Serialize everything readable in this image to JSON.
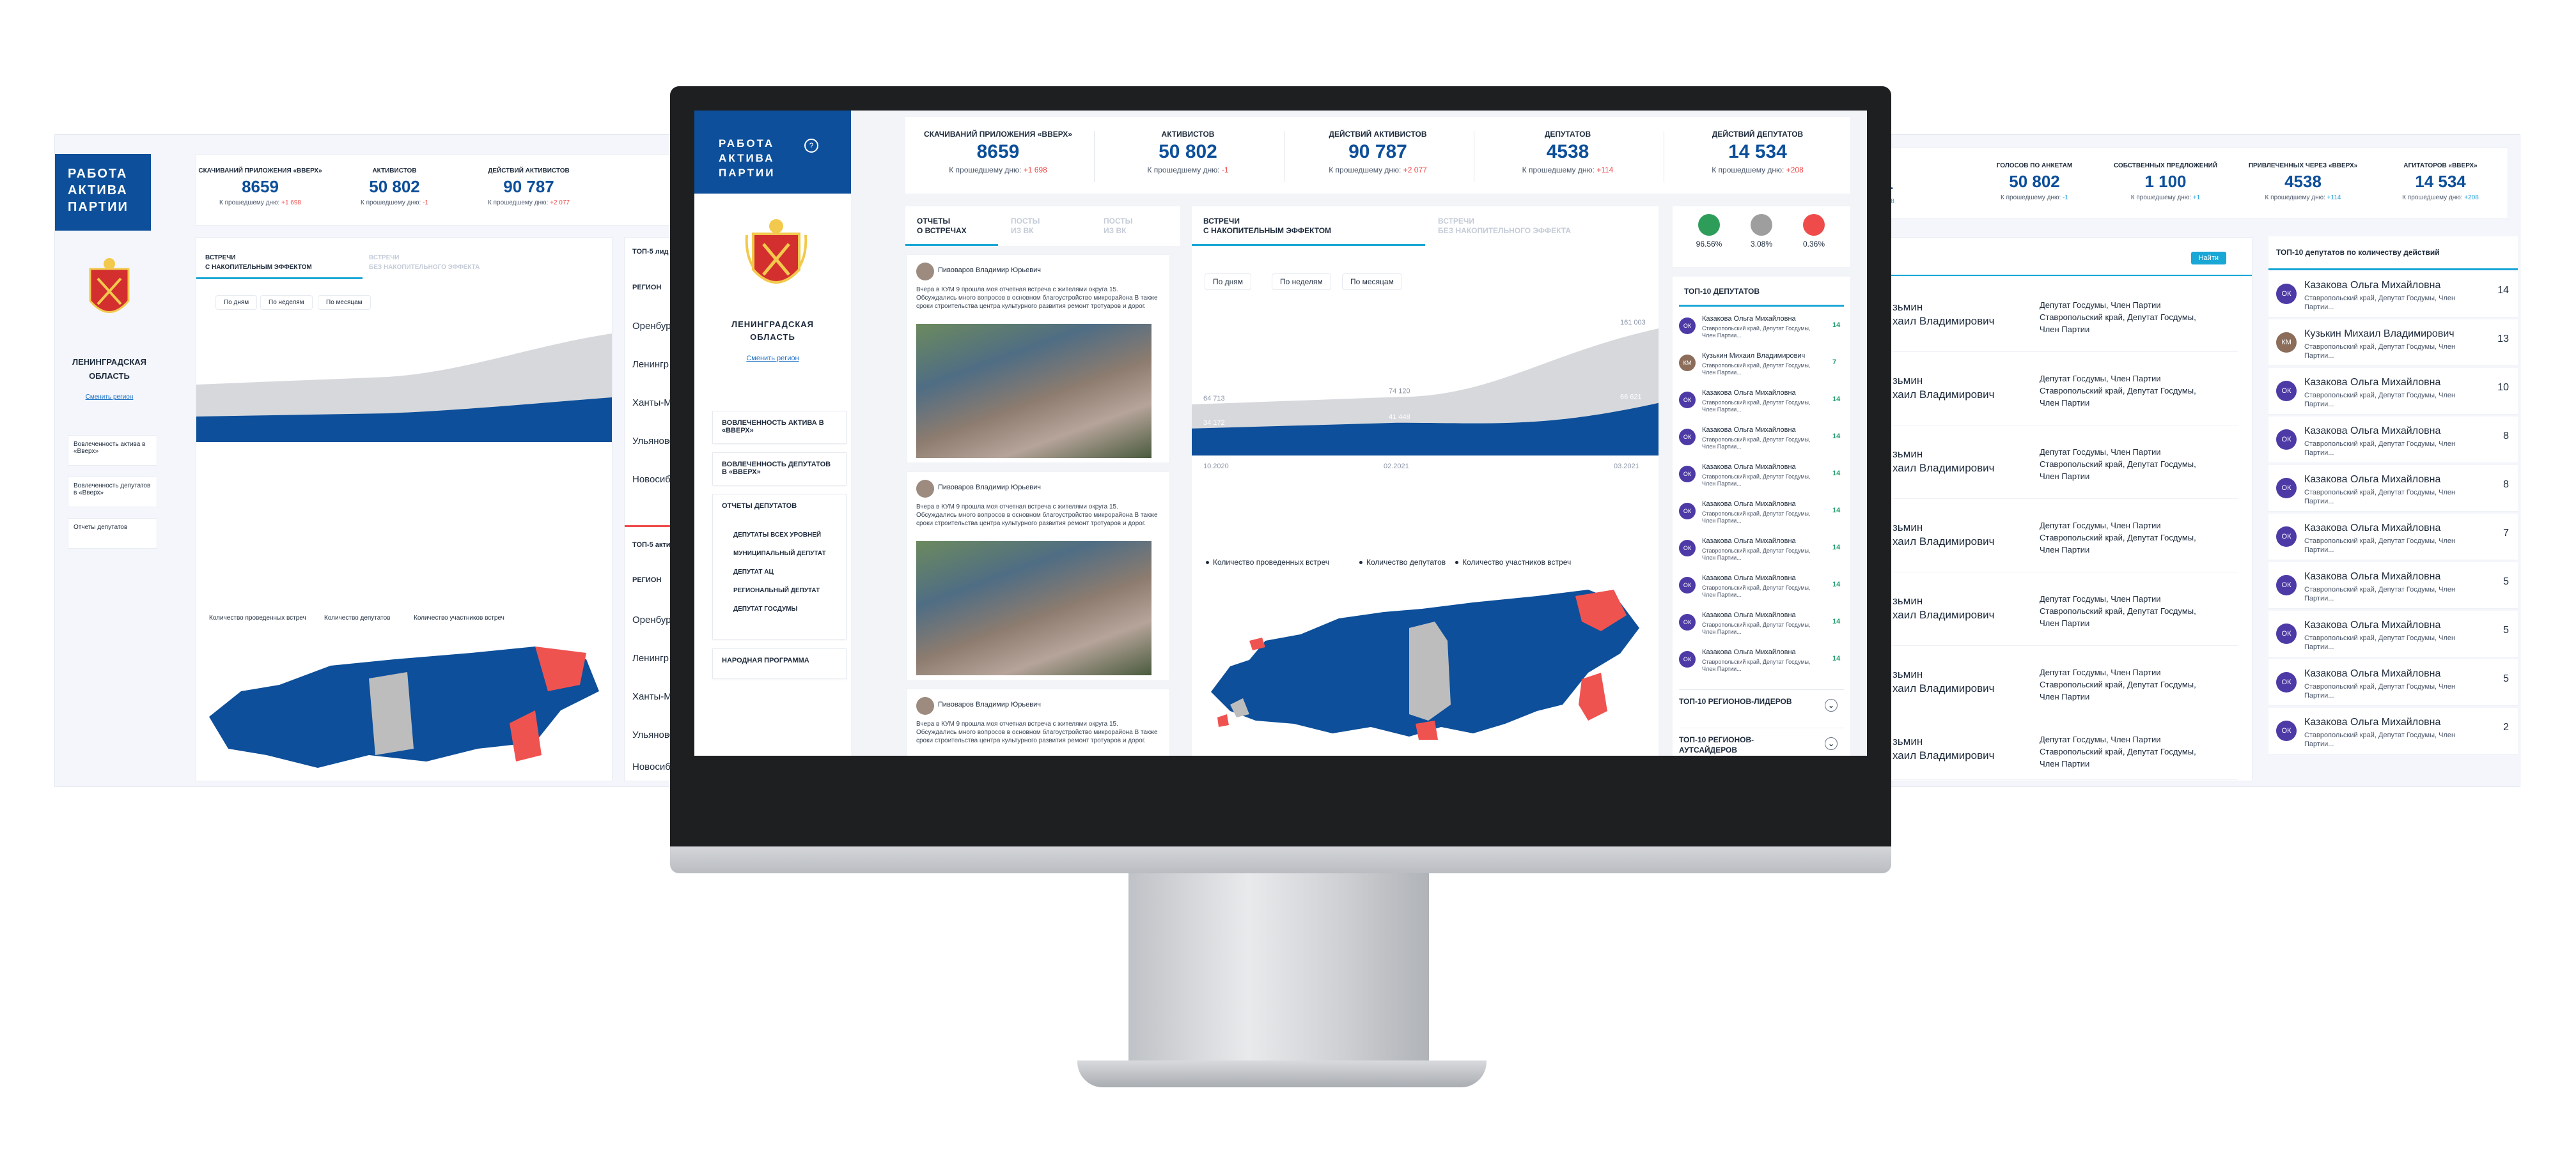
{
  "brand": {
    "title_lines": [
      "РАБОТА",
      "АКТИВА",
      "ПАРТИИ"
    ],
    "info_glyph": "?"
  },
  "region": {
    "name_lines": [
      "ЛЕНИНГРАДСКАЯ",
      "ОБЛАСТЬ"
    ],
    "change_link": "Сменить регион"
  },
  "stats": [
    {
      "title": "Скачиваний приложения «Вверх»",
      "value": "8659",
      "sub": "К прошедшему дню:",
      "delta": "+1 698",
      "delta_color": "#ef4b4b"
    },
    {
      "title": "Активистов",
      "value": "50 802",
      "sub": "К прошедшему дню:",
      "delta": "-1",
      "delta_color": "#ef4b4b"
    },
    {
      "title": "Действий активистов",
      "value": "90 787",
      "sub": "К прошедшему дню:",
      "delta": "+2 077",
      "delta_color": "#ef4b4b"
    },
    {
      "title": "Депутатов",
      "value": "4538",
      "sub": "К прошедшему дню:",
      "delta": "+114",
      "delta_color": "#ef4b4b"
    },
    {
      "title": "Действий депутатов",
      "value": "14 534",
      "sub": "К прошедшему дню:",
      "delta": "+208",
      "delta_color": "#ef4b4b"
    }
  ],
  "sidebar_menu": {
    "item1": "Вовлеченность актива в «Вверх»",
    "item2": "Вовлеченность депутатов в «Вверх»",
    "item3": "Отчеты депутатов",
    "sub": [
      "Депутаты всех уровней",
      "Муниципальный депутат",
      "Депутат АЦ",
      "Региональный депутат",
      "Депутат Госдумы"
    ],
    "item4": "Народная программа"
  },
  "feed_tabs": {
    "active": [
      "Отчеты",
      "о встречах"
    ],
    "tab2": [
      "Посты",
      "из ВК"
    ],
    "tab3": [
      "Посты",
      "из ВК"
    ]
  },
  "posts": [
    {
      "author": "Пивоваров Владимир Юрьевич",
      "text": "Вчера в КУМ 9 прошла моя отчетная встреча с жителями округа 15. Обсуждались много вопросов в основном благоустройство микрорайона В также сроки строительства центра культурного развития ремонт тротуаров и дорог."
    },
    {
      "author": "Пивоваров Владимир Юрьевич",
      "text": "Вчера в КУМ 9 прошла моя отчетная встреча с жителями округа 15. Обсуждались много вопросов в основном благоустройство микрорайона В также сроки строительства центра культурного развития ремонт тротуаров и дорог."
    },
    {
      "author": "Пивоваров Владимир Юрьевич",
      "text": "Вчера в КУМ 9 прошла моя отчетная встреча с жителями округа 15. Обсуждались много вопросов в основном благоустройство микрорайона В также сроки строительства центра культурного развития ремонт тротуаров и дорог."
    }
  ],
  "chart_tabs": {
    "active": [
      "Встречи",
      "с накопительным эффектом"
    ],
    "inactive": [
      "Встречи",
      "без накопительного эффекта"
    ]
  },
  "filters": [
    "По дням",
    "По неделям",
    "По месяцам"
  ],
  "chart_data": {
    "type": "area",
    "x": [
      "10.2020",
      "02.2021",
      "03.2021"
    ],
    "series": [
      {
        "name": "Количество проведенных встреч",
        "values": [
          34172,
          41448,
          66621
        ],
        "color": "#0d4f9a"
      },
      {
        "name": "Количество участников встреч",
        "values": [
          64713,
          74120,
          161003
        ],
        "color": "#d6d8dc"
      }
    ],
    "point_labels": {
      "low": [
        "34 172",
        "41 448",
        "66 621"
      ],
      "high": [
        "64 713",
        "74 120",
        "161 003"
      ]
    },
    "legend": [
      "Количество проведенных встреч",
      "Количество депутатов",
      "Количество участников встреч"
    ]
  },
  "map": {
    "colors": {
      "main": "#0d4f9a",
      "neutral": "#bdbdbd",
      "alert": "#ef5350"
    }
  },
  "percentages": [
    {
      "value": "96.56%",
      "color": "#2e9d5a"
    },
    {
      "value": "3.08%",
      "color": "#9e9e9e"
    },
    {
      "value": "0.36%",
      "color": "#ef4b4b"
    }
  ],
  "top_deputies": {
    "title": "ТОП-10 депутатов",
    "rows": [
      {
        "initials": "ОК",
        "name": "Казакова Ольга Михайловна",
        "meta": "Ставропольский край, Депутат Госдумы, Член Партии...",
        "count": "14"
      },
      {
        "initials": "КМ",
        "name": "Кузькин Михаил Владимирович",
        "meta": "Ставропольский край, Депутат Госдумы, Член Партии...",
        "count": "7"
      },
      {
        "initials": "ОК",
        "name": "Казакова Ольга Михайловна",
        "meta": "Ставропольский край, Депутат Госдумы, Член Партии...",
        "count": "14"
      },
      {
        "initials": "ОК",
        "name": "Казакова Ольга Михайловна",
        "meta": "Ставропольский край, Депутат Госдумы, Член Партии...",
        "count": "14"
      },
      {
        "initials": "ОК",
        "name": "Казакова Ольга Михайловна",
        "meta": "Ставропольский край, Депутат Госдумы, Член Партии...",
        "count": "14"
      },
      {
        "initials": "ОК",
        "name": "Казакова Ольга Михайловна",
        "meta": "Ставропольский край, Депутат Госдумы, Член Партии...",
        "count": "14"
      },
      {
        "initials": "ОК",
        "name": "Казакова Ольга Михайловна",
        "meta": "Ставропольский край, Депутат Госдумы, Член Партии...",
        "count": "14"
      },
      {
        "initials": "ОК",
        "name": "Казакова Ольга Михайловна",
        "meta": "Ставропольский край, Депутат Госдумы, Член Партии...",
        "count": "14"
      },
      {
        "initials": "ОК",
        "name": "Казакова Ольга Михайловна",
        "meta": "Ставропольский край, Депутат Госдумы, Член Партии...",
        "count": "14"
      },
      {
        "initials": "ОК",
        "name": "Казакова Ольга Михайловна",
        "meta": "Ставропольский край, Депутат Госдумы, Член Партии...",
        "count": "14"
      }
    ],
    "leaders": "ТОП-10 регионов-лидеров",
    "outsiders": "ТОП-10 регионов-аутсайдеров"
  },
  "left_side": {
    "stats": [
      {
        "title": "Скачиваний приложения «Вверх»",
        "value": "8659",
        "sub": "К прошедшему дню:",
        "delta": "+1 698"
      },
      {
        "title": "Активистов",
        "value": "50 802",
        "sub": "К прошедшему дню:",
        "delta": "-1"
      },
      {
        "title": "Действий активистов",
        "value": "90 787",
        "sub": "К прошедшему дню:",
        "delta": "+2 077"
      }
    ],
    "tabs": {
      "active": [
        "Встречи",
        "с накопительным эффектом"
      ],
      "inactive": [
        "Встречи",
        "без накопительного эффекта"
      ]
    },
    "filters": [
      "По дням",
      "По неделям",
      "По месяцам"
    ],
    "legend": [
      "Количество проведенных встреч",
      "Количество депутатов",
      "Количество участников встреч"
    ],
    "menu": [
      "Вовлеченность актива в «Вверх»",
      "Вовлеченность депутатов в «Вверх»",
      "Отчеты депутатов"
    ],
    "top5": "ТОП-5 лид",
    "top5b": "ТОП-5 акти",
    "region_col": "РЕГИОН",
    "regions": [
      "Оренбург",
      "Ленингр",
      "Ханты-Ма",
      "Ульяновс",
      "Новосиб"
    ],
    "regions2": [
      "Оренбург",
      "Ленингр",
      "Ханты-Ма",
      "Ульяновс",
      "Новосиб"
    ]
  },
  "right_side": {
    "stats": [
      {
        "title": "Голосов по анкетам",
        "value": "50 802",
        "sub": "К прошедшему дню:",
        "delta": "-1"
      },
      {
        "title": "Собственных предложений",
        "value": "1 100",
        "sub": "К прошедшему дню:",
        "delta": "+1"
      },
      {
        "title": "Привлеченных через «Вверх»",
        "value": "4538",
        "sub": "К прошедшему дню:",
        "delta": "+114"
      },
      {
        "title": "Агитаторов «Вверх»",
        "value": "14 534",
        "sub": "К прошедшему дню:",
        "delta": "+208"
      }
    ],
    "partial_value": "51",
    "partial_delta": "+1 698",
    "button": "Найти",
    "mid_rows": [
      {
        "name": [
          "зьмин",
          "хаил Владимирович"
        ],
        "meta": [
          "Депутат Госдумы, Член Партии",
          "Ставропольский край, Депутат Госдумы,",
          "Член Партии"
        ]
      },
      {
        "name": [
          "зьмин",
          "хаил Владимирович"
        ],
        "meta": [
          "Депутат Госдумы, Член Партии",
          "Ставропольский край, Депутат Госдумы,",
          "Член Партии"
        ]
      },
      {
        "name": [
          "зьмин",
          "хаил Владимирович"
        ],
        "meta": [
          "Депутат Госдумы, Член Партии",
          "Ставропольский край, Депутат Госдумы,",
          "Член Партии"
        ]
      },
      {
        "name": [
          "зьмин",
          "хаил Владимирович"
        ],
        "meta": [
          "Депутат Госдумы, Член Партии",
          "Ставропольский край, Депутат Госдумы,",
          "Член Партии"
        ]
      },
      {
        "name": [
          "зьмин",
          "хаил Владимирович"
        ],
        "meta": [
          "Депутат Госдумы, Член Партии",
          "Ставропольский край, Депутат Госдумы,",
          "Член Партии"
        ]
      },
      {
        "name": [
          "зьмин",
          "хаил Владимирович"
        ],
        "meta": [
          "Депутат Госдумы, Член Партии",
          "Ставропольский край, Депутат Госдумы,",
          "Член Партии"
        ]
      },
      {
        "name": [
          "зьмин",
          "хаил Владимирович"
        ],
        "meta": [
          "Депутат Госдумы, Член Партии",
          "Ставропольский край, Депутат Госдумы,",
          "Член Партии"
        ]
      }
    ],
    "list_title": "ТОП-10 депутатов по количеству действий",
    "list": [
      {
        "initials": "ОК",
        "name": "Казакова Ольга Михайловна",
        "meta": "Ставропольский край, Депутат Госдумы, Член Партии...",
        "count": "14"
      },
      {
        "initials": "КМ",
        "name": "Кузькин Михаил Владимирович",
        "meta": "Ставропольский край, Депутат Госдумы, Член Партии...",
        "count": "13"
      },
      {
        "initials": "ОК",
        "name": "Казакова Ольга Михайловна",
        "meta": "Ставропольский край, Депутат Госдумы, Член Партии...",
        "count": "10"
      },
      {
        "initials": "ОК",
        "name": "Казакова Ольга Михайловна",
        "meta": "Ставропольский край, Депутат Госдумы, Член Партии...",
        "count": "8"
      },
      {
        "initials": "ОК",
        "name": "Казакова Ольга Михайловна",
        "meta": "Ставропольский край, Депутат Госдумы, Член Партии...",
        "count": "8"
      },
      {
        "initials": "ОК",
        "name": "Казакова Ольга Михайловна",
        "meta": "Ставропольский край, Депутат Госдумы, Член Партии...",
        "count": "7"
      },
      {
        "initials": "ОК",
        "name": "Казакова Ольга Михайловна",
        "meta": "Ставропольский край, Депутат Госдумы, Член Партии...",
        "count": "5"
      },
      {
        "initials": "ОК",
        "name": "Казакова Ольга Михайловна",
        "meta": "Ставропольский край, Депутат Госдумы, Член Партии...",
        "count": "5"
      },
      {
        "initials": "ОК",
        "name": "Казакова Ольга Михайловна",
        "meta": "Ставропольский край, Депутат Госдумы, Член Партии...",
        "count": "5"
      },
      {
        "initials": "ОК",
        "name": "Казакова Ольга Михайловна",
        "meta": "Ставропольский край, Депутат Госдумы, Член Партии...",
        "count": "2"
      }
    ]
  }
}
